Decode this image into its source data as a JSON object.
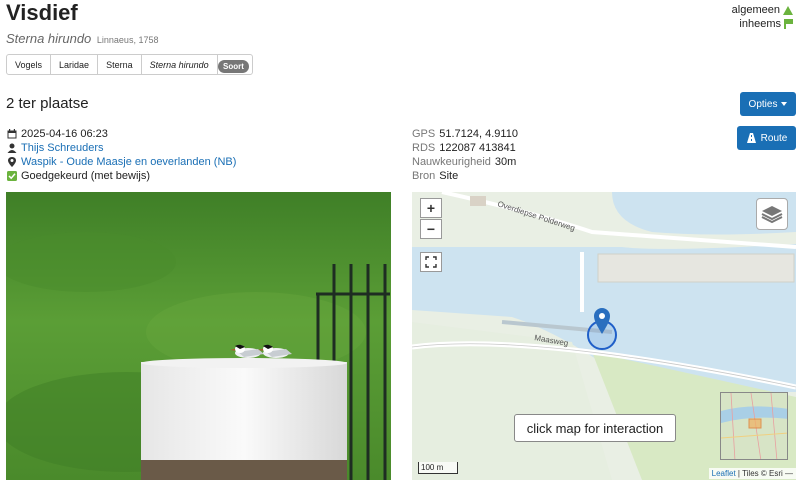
{
  "species": {
    "common_name": "Visdief",
    "scientific_name": "Sterna hirundo",
    "authority": "Linnaeus, 1758"
  },
  "status": {
    "abundance": "algemeen",
    "native": "inheems"
  },
  "taxonomy": {
    "items": [
      "Vogels",
      "Laridae",
      "Sterna",
      "Sterna hirundo"
    ],
    "rank_badge": "Soort"
  },
  "observation": {
    "count_label": "2 ter plaatse",
    "datetime": "2025-04-16 06:23",
    "observer": "Thijs Schreuders",
    "location": "Waspik - Oude Maasje en oeverlanden (NB)",
    "validation": "Goedgekeurd (met bewijs)"
  },
  "geo": {
    "gps_label": "GPS",
    "gps_value": "51.7124, 4.9110",
    "rds_label": "RDS",
    "rds_value": "122087 413841",
    "accuracy_label": "Nauwkeurigheid",
    "accuracy_value": "30m",
    "source_label": "Bron",
    "source_value": "Site"
  },
  "buttons": {
    "options": "Opties",
    "route": "Route"
  },
  "map": {
    "zoom_in": "+",
    "zoom_out": "−",
    "interaction_hint": "click map for interaction",
    "scale": "100 m",
    "attribution_leaflet": "Leaflet",
    "attribution_rest": "| Tiles © Esri —",
    "road_labels": [
      "Overdiepse Polderweg",
      "Maasweg"
    ]
  },
  "colors": {
    "primary": "#1a6fb5",
    "status_green": "#6bb33e",
    "water": "#cde3f0"
  }
}
